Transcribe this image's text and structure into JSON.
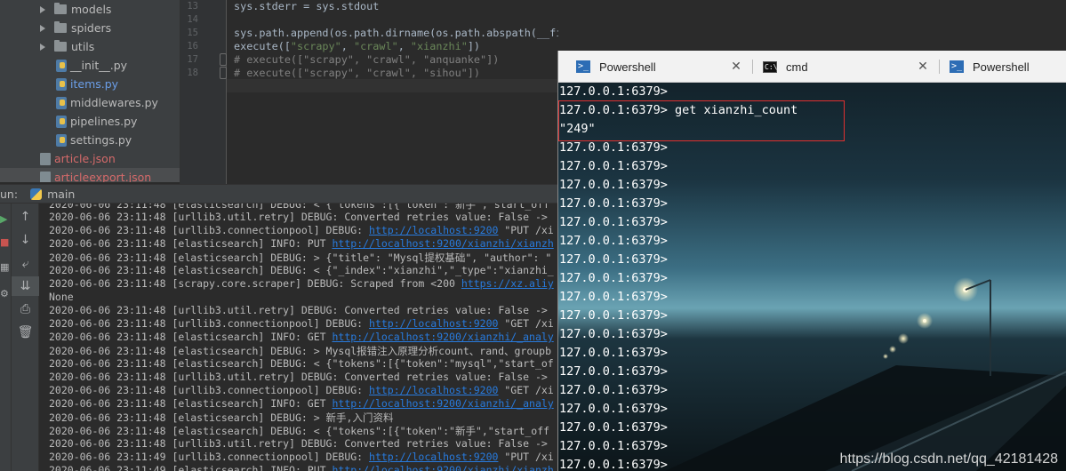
{
  "project_tree": {
    "items": [
      {
        "label": "models",
        "kind": "folder"
      },
      {
        "label": "spiders",
        "kind": "folder"
      },
      {
        "label": "utils",
        "kind": "folder"
      },
      {
        "label": "__init__.py",
        "kind": "py"
      },
      {
        "label": "items.py",
        "kind": "py"
      },
      {
        "label": "middlewares.py",
        "kind": "py"
      },
      {
        "label": "pipelines.py",
        "kind": "py"
      },
      {
        "label": "settings.py",
        "kind": "py"
      },
      {
        "label": "article.json",
        "kind": "json"
      },
      {
        "label": "articleexport.json",
        "kind": "json"
      }
    ]
  },
  "editor": {
    "line_numbers": [
      "13",
      "14",
      "15",
      "16",
      "17",
      "18"
    ],
    "lines": [
      "sys.stderr = sys.stdout",
      "",
      "sys.path.append(os.path.dirname(os.path.abspath(__file__)))",
      "execute([\"scrapy\", \"crawl\", \"xianzhi\"])",
      "# execute([\"scrapy\", \"crawl\", \"anquanke\"])",
      "# execute([\"scrapy\", \"crawl\", \"sihou\"])"
    ]
  },
  "run_panel": {
    "label": "un:",
    "config_name": "main",
    "log_lines": [
      {
        "text": "2020-06-06 23:11:48 [elasticsearch] DEBUG: < {\"tokens\":[{\"token\":\"新手\",\"start_off",
        "link": ""
      },
      {
        "text": "2020-06-06 23:11:48 [urllib3.util.retry] DEBUG: Converted retries value: False -> ",
        "link": ""
      },
      {
        "text": "2020-06-06 23:11:48 [urllib3.connectionpool] DEBUG: ",
        "link": "http://localhost:9200",
        "after": " \"PUT /xi"
      },
      {
        "text": "2020-06-06 23:11:48 [elasticsearch] INFO: PUT ",
        "link": "http://localhost:9200/xianzhi/xianzh",
        "after": ""
      },
      {
        "text": "2020-06-06 23:11:48 [elasticsearch] DEBUG: > {\"title\": \"Mysql提权基础\", \"author\": \"",
        "link": ""
      },
      {
        "text": "2020-06-06 23:11:48 [elasticsearch] DEBUG: < {\"_index\":\"xianzhi\",\"_type\":\"xianzhi_",
        "link": ""
      },
      {
        "text": "2020-06-06 23:11:48 [scrapy.core.scraper] DEBUG: Scraped from <200 ",
        "link": "https://xz.aliy",
        "after": ""
      },
      {
        "text": "None",
        "link": ""
      },
      {
        "text": "2020-06-06 23:11:48 [urllib3.util.retry] DEBUG: Converted retries value: False -> ",
        "link": ""
      },
      {
        "text": "2020-06-06 23:11:48 [urllib3.connectionpool] DEBUG: ",
        "link": "http://localhost:9200",
        "after": " \"GET /xi"
      },
      {
        "text": "2020-06-06 23:11:48 [elasticsearch] INFO: GET ",
        "link": "http://localhost:9200/xianzhi/_analy",
        "after": ""
      },
      {
        "text": "2020-06-06 23:11:48 [elasticsearch] DEBUG: > Mysql报错注入原理分析count、rand、groupb",
        "link": ""
      },
      {
        "text": "2020-06-06 23:11:48 [elasticsearch] DEBUG: < {\"tokens\":[{\"token\":\"mysql\",\"start_of",
        "link": ""
      },
      {
        "text": "2020-06-06 23:11:48 [urllib3.util.retry] DEBUG: Converted retries value: False -> ",
        "link": ""
      },
      {
        "text": "2020-06-06 23:11:48 [urllib3.connectionpool] DEBUG: ",
        "link": "http://localhost:9200",
        "after": " \"GET /xi"
      },
      {
        "text": "2020-06-06 23:11:48 [elasticsearch] INFO: GET ",
        "link": "http://localhost:9200/xianzhi/_analy",
        "after": ""
      },
      {
        "text": "2020-06-06 23:11:48 [elasticsearch] DEBUG: > 新手,入门资料",
        "link": ""
      },
      {
        "text": "2020-06-06 23:11:48 [elasticsearch] DEBUG: < {\"tokens\":[{\"token\":\"新手\",\"start_off",
        "link": ""
      },
      {
        "text": "2020-06-06 23:11:48 [urllib3.util.retry] DEBUG: Converted retries value: False -> ",
        "link": ""
      },
      {
        "text": "2020-06-06 23:11:49 [urllib3.connectionpool] DEBUG: ",
        "link": "http://localhost:9200",
        "after": " \"PUT /xi"
      },
      {
        "text": "2020-06-06 23:11:49 [elasticsearch] INFO: PUT ",
        "link": "http://localhost:9200/xianzhi/xianzh",
        "after": ""
      }
    ]
  },
  "terminal": {
    "tabs": [
      {
        "label": "Powershell",
        "icon": "powershell-icon"
      },
      {
        "label": "cmd",
        "icon": "cmd-icon"
      },
      {
        "label": "Powershell",
        "icon": "powershell-icon"
      }
    ],
    "lines": [
      "127.0.0.1:6379>",
      "127.0.0.1:6379> get xianzhi_count",
      "\"249\"",
      "127.0.0.1:6379>",
      "127.0.0.1:6379>",
      "127.0.0.1:6379>",
      "127.0.0.1:6379>",
      "127.0.0.1:6379>",
      "127.0.0.1:6379>",
      "127.0.0.1:6379>",
      "127.0.0.1:6379>",
      "127.0.0.1:6379>",
      "127.0.0.1:6379>",
      "127.0.0.1:6379>",
      "127.0.0.1:6379>",
      "127.0.0.1:6379>",
      "127.0.0.1:6379>",
      "127.0.0.1:6379>",
      "127.0.0.1:6379>",
      "127.0.0.1:6379>",
      "127.0.0.1:6379>"
    ],
    "watermark": "https://blog.csdn.net/qq_42181428"
  },
  "colors": {
    "highlight_box": "#e03030",
    "link": "#287bde"
  }
}
